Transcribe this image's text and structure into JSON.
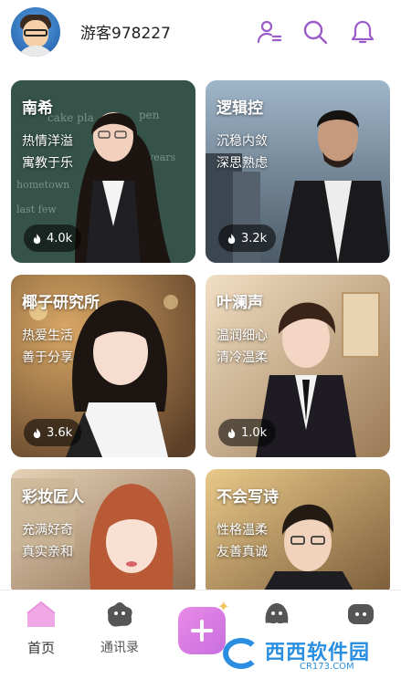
{
  "header": {
    "username": "游客978227",
    "icons": [
      "contacts-icon",
      "search-icon",
      "bell-icon"
    ]
  },
  "cards": [
    {
      "name": "南希",
      "tags": [
        "热情洋溢",
        "寓教于乐"
      ],
      "hot": "4.0k"
    },
    {
      "name": "逻辑控",
      "tags": [
        "沉稳内敛",
        "深思熟虑"
      ],
      "hot": "3.2k"
    },
    {
      "name": "椰子研究所",
      "tags": [
        "热爱生活",
        "善于分享"
      ],
      "hot": "3.6k"
    },
    {
      "name": "叶澜声",
      "tags": [
        "温润细心",
        "清冷温柔"
      ],
      "hot": "1.0k"
    },
    {
      "name": "彩妆匠人",
      "tags": [
        "充满好奇",
        "真实亲和"
      ],
      "hot": ""
    },
    {
      "name": "不会写诗",
      "tags": [
        "性格温柔",
        "友善真诚"
      ],
      "hot": ""
    }
  ],
  "nav": {
    "home": "首页",
    "contacts": "通讯录",
    "create": "+",
    "sparkle": "✦"
  },
  "watermark": {
    "text": "西西软件园",
    "sub": "CR173.COM"
  },
  "colors": {
    "accent": "#9b5cc9",
    "home_icon": "#f0a7e6",
    "create_btn": "#d77de3"
  }
}
